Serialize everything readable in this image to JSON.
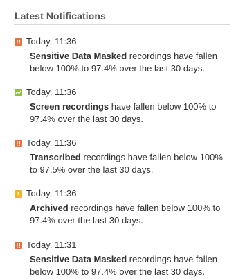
{
  "panel": {
    "title": "Latest Notifications"
  },
  "colors": {
    "critical": "#e8703a",
    "success": "#8fc13e",
    "warning": "#f3b229"
  },
  "notifications": [
    {
      "icon": "critical-alert-icon",
      "status_color": "#e8703a",
      "time": "Today, 11:36",
      "subject": "Sensitive Data Masked",
      "message": " recordings have fallen below 100% to 97.4% over the last 30 days."
    },
    {
      "icon": "trend-icon",
      "status_color": "#8fc13e",
      "time": "Today, 11:36",
      "subject": "Screen recordings",
      "message": " have fallen below 100% to 97.4% over the last 30 days."
    },
    {
      "icon": "critical-alert-icon",
      "status_color": "#e8703a",
      "time": "Today, 11:36",
      "subject": "Transcribed",
      "message": " recordings have fallen below 100% to 97.5% over the last 30 days."
    },
    {
      "icon": "warning-icon",
      "status_color": "#f3b229",
      "time": "Today, 11:36",
      "subject": "Archived",
      "message": " recordings have fallen below 100% to 97.4% over the last 30 days."
    },
    {
      "icon": "critical-alert-icon",
      "status_color": "#e8703a",
      "time": "Today, 11:31",
      "subject": "Sensitive Data Masked",
      "message": " recordings have fallen below 100% to 97.4% over the last 30 days."
    }
  ]
}
